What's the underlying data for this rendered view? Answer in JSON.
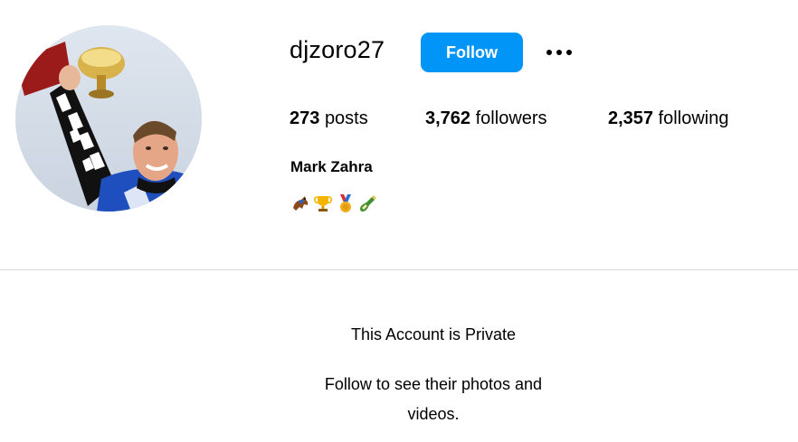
{
  "profile": {
    "username": "djzoro27",
    "follow_label": "Follow",
    "more_icon": "more-options-icon",
    "full_name": "Mark Zahra",
    "bio_emojis": [
      "racehorse-emoji",
      "trophy-emoji",
      "medal-emoji",
      "champagne-emoji"
    ],
    "avatar": "profile-photo",
    "accent_color": "#0095f6"
  },
  "stats": {
    "posts_count": "273",
    "posts_label": "posts",
    "followers_count": "3,762",
    "followers_label": "followers",
    "following_count": "2,357",
    "following_label": "following"
  },
  "private_notice": {
    "title": "This Account is Private",
    "subtitle": "Follow to see their photos and videos."
  }
}
